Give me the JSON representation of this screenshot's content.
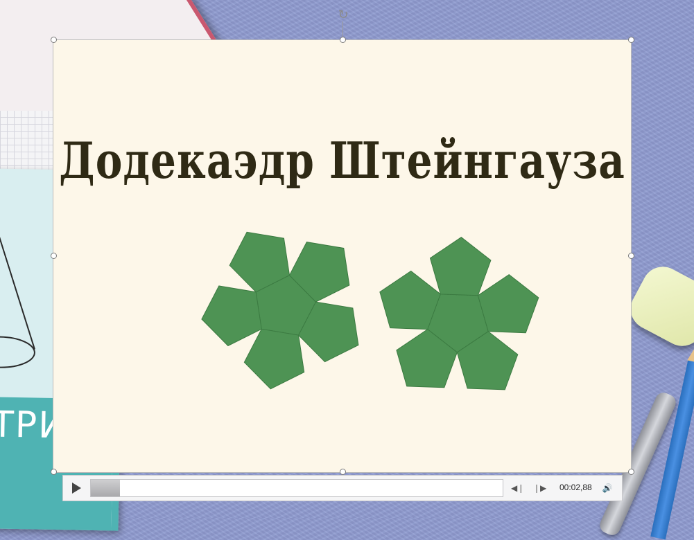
{
  "slide": {
    "title": "Додекаэдр Штейнгауза",
    "net_color": "#4e9354"
  },
  "background": {
    "cover_text": "ТРИ"
  },
  "player": {
    "play_icon": "play-icon",
    "time": "00:02,88",
    "progress": 0.07,
    "back_icon": "step-back-icon",
    "forward_icon": "step-forward-icon",
    "volume_icon": "volume-icon"
  }
}
